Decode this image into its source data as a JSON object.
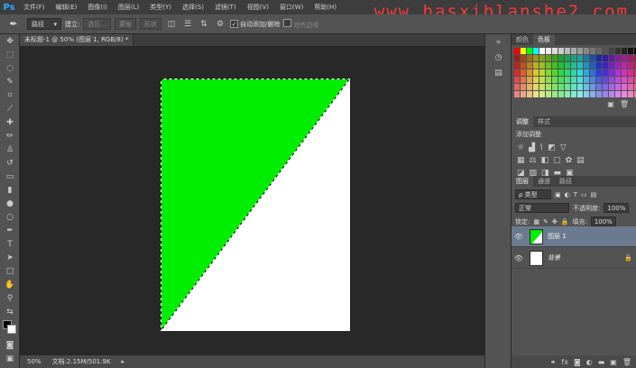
{
  "menubar": {
    "logo": "Ps",
    "items": [
      "文件(F)",
      "编辑(E)",
      "图像(I)",
      "图层(L)",
      "类型(Y)",
      "选择(S)",
      "滤镜(T)",
      "视图(V)",
      "窗口(W)",
      "帮助(H)"
    ],
    "watermark": "www.hasxiblanshe2.com"
  },
  "options": {
    "tool_icon": "pen-icon",
    "mode_value": "路径",
    "make_label": "建立:",
    "selection_label": "选区...",
    "mask_label": "蒙版",
    "shape_label": "形状",
    "auto_add_delete": "自动添加/删除",
    "align_edges": "对齐边缘"
  },
  "document": {
    "tab_title": "未标题-1 @ 50% (图层 1, RGB/8) *",
    "zoom": "50%",
    "doc_info": "文档:2.15M/501.9K",
    "colors": {
      "green": "#00ee00",
      "white": "#ffffff"
    }
  },
  "panels": {
    "swatch_tabs": [
      "颜色",
      "色板"
    ],
    "adjustment_tabs": [
      "调整",
      "样式"
    ],
    "adjustment_title": "添加调整",
    "layers_tabs": [
      "图层",
      "通道",
      "路径"
    ],
    "filter_kind": "ρ 类型",
    "blend_mode": "正常",
    "opacity_label": "不透明度:",
    "opacity_value": "100%",
    "lock_label": "锁定:",
    "fill_label": "填充:",
    "fill_value": "100%",
    "layers": [
      {
        "name": "图层 1"
      },
      {
        "name": "背景"
      }
    ]
  }
}
